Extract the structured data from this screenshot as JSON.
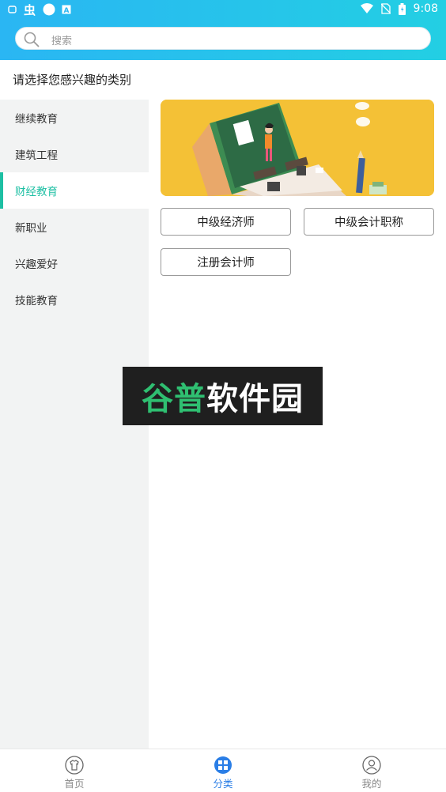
{
  "status_bar": {
    "time": "9:08",
    "left_icons": [
      "notification-icon",
      "bug-icon",
      "circle-icon",
      "a-icon"
    ],
    "right_icons": [
      "wifi-icon",
      "no-sim-icon",
      "battery-icon"
    ]
  },
  "search": {
    "placeholder": "搜索"
  },
  "page_title": "请选择您感兴趣的类别",
  "sidebar": {
    "items": [
      {
        "label": "继续教育",
        "active": false
      },
      {
        "label": "建筑工程",
        "active": false
      },
      {
        "label": "财经教育",
        "active": true
      },
      {
        "label": "新职业",
        "active": false
      },
      {
        "label": "兴趣爱好",
        "active": false
      },
      {
        "label": "技能教育",
        "active": false
      }
    ]
  },
  "categories": [
    {
      "label": "中级经济师"
    },
    {
      "label": "中级会计职称"
    },
    {
      "label": "注册会计师"
    }
  ],
  "watermark": {
    "part1": "谷普",
    "part2": "软件园"
  },
  "bottom_nav": {
    "tabs": [
      {
        "label": "首页",
        "icon": "home-shirt-icon",
        "active": false
      },
      {
        "label": "分类",
        "icon": "category-icon",
        "active": true
      },
      {
        "label": "我的",
        "icon": "user-icon",
        "active": false
      }
    ]
  },
  "colors": {
    "header_start": "#2ab6f3",
    "header_end": "#23cfe3",
    "accent": "#1dbfa3",
    "nav_active": "#2a7ee6",
    "banner_bg": "#f4c136"
  }
}
